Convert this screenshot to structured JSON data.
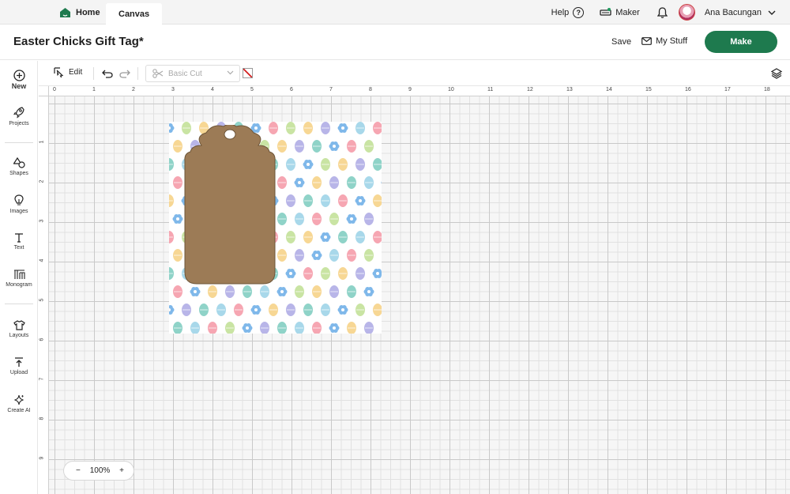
{
  "topnav": {
    "home_label": "Home",
    "canvas_label": "Canvas",
    "help_label": "Help",
    "maker_label": "Maker",
    "user_name": "Ana Bacungan"
  },
  "header": {
    "title": "Easter Chicks Gift Tag*",
    "save_label": "Save",
    "mystuff_label": "My Stuff",
    "make_label": "Make"
  },
  "sidebar": {
    "new_label": "New",
    "items": [
      {
        "label": "Projects"
      },
      {
        "label": "Shapes"
      },
      {
        "label": "Images"
      },
      {
        "label": "Text"
      },
      {
        "label": "Monogram"
      },
      {
        "label": "Layouts"
      },
      {
        "label": "Upload"
      },
      {
        "label": "Create AI"
      }
    ]
  },
  "toolbar": {
    "edit_label": "Edit",
    "operation": "Basic Cut"
  },
  "ruler": {
    "top": [
      "0",
      "1",
      "2",
      "3",
      "4",
      "5",
      "6",
      "7",
      "8",
      "9",
      "10",
      "11",
      "12",
      "13",
      "14",
      "15",
      "16",
      "17",
      "18"
    ],
    "left": [
      "1",
      "2",
      "3",
      "4",
      "5",
      "6",
      "7",
      "8",
      "9"
    ]
  },
  "canvas_object": {
    "tag_color": "#9c7b56",
    "pattern_colors": [
      "#a8d8ea",
      "#f6a6b2",
      "#c9e4a3",
      "#f7d794",
      "#b8b5e8",
      "#8fd3c8"
    ]
  },
  "zoom": {
    "minus": "−",
    "value": "100%",
    "plus": "+"
  },
  "colors": {
    "make_button": "#1e7a4e",
    "tag": "#9c7b56"
  }
}
